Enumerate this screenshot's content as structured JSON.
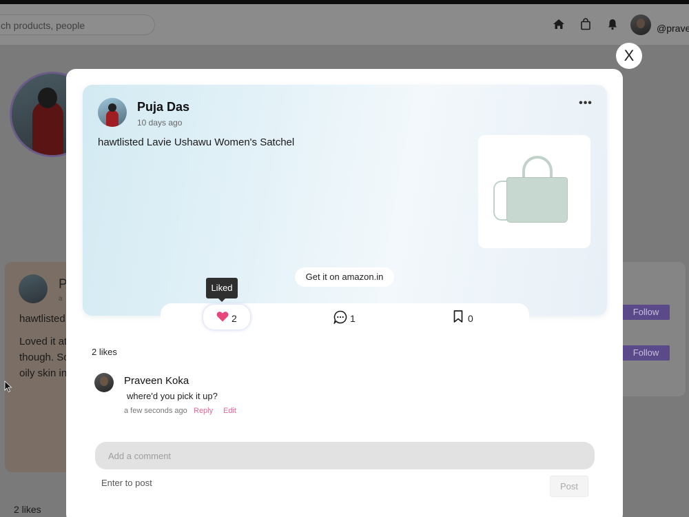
{
  "navbar": {
    "search_placeholder": "ch products, people",
    "user_handle": "@pravee",
    "icons": [
      "home-icon",
      "bag-icon",
      "bell-icon"
    ]
  },
  "background": {
    "card_initial": "P",
    "card_subtext": "a",
    "card_lines": [
      "hawtlisted",
      "Loved it at",
      "though. So",
      "oily skin in"
    ],
    "likes": "2 likes",
    "follow_label": "Follow"
  },
  "modal": {
    "close_label": "X",
    "post": {
      "author": "Puja Das",
      "time": "10 days ago",
      "more_label": "•••",
      "text": "hawtlisted Lavie Ushawu Women's Satchel",
      "product_image": "green-satchel-bag",
      "buy_button": "Get it on amazon.in"
    },
    "actions": {
      "like_count": "2",
      "like_tooltip": "Liked",
      "comment_count": "1",
      "bookmark_count": "0"
    },
    "likes_summary": "2 likes",
    "comments": [
      {
        "author": "Praveen Koka",
        "text": "where'd you pick it up?",
        "time": "a few seconds ago",
        "reply_label": "Reply",
        "edit_label": "Edit"
      }
    ],
    "composer": {
      "placeholder": "Add a comment",
      "hint": "Enter to post",
      "post_label": "Post"
    }
  },
  "colors": {
    "accent_pink": "#e06a93",
    "heart": "#e8457a",
    "follow_purple": "#5a4a8a",
    "card_gradient_start": "#d3eaf2"
  }
}
